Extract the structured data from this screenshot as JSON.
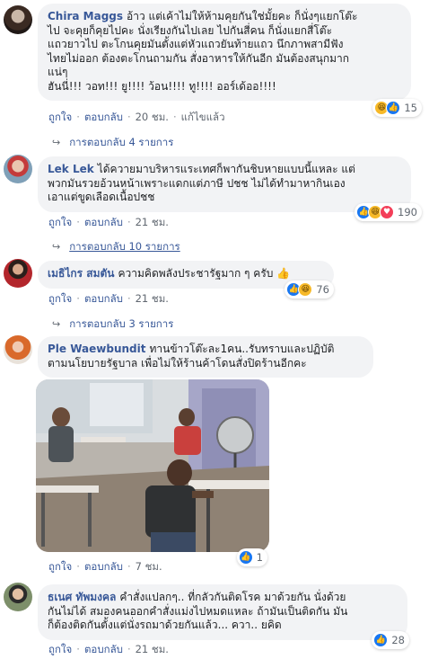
{
  "comments": [
    {
      "author": "Chira Maggs",
      "text_lines": [
        "อ้าว แต่เค้าไม่ให้ห้ามคุยกันใช่มั้ยคะ ก็นั่งๆแยกโต๊ะ",
        "ไป จะคุยก็คุยไปคะ นั่งเรียงกันไปเลย ไปกันสี่คน ก็นั่งแยกสี่โต๊ะ",
        "แถวยาวไป ตะโกนคุยมันตั้งแต่หัวแถวยันท้ายแถว นึกภาพสามีฟัง",
        "ไทยไม่ออก ต้องตะโกนถามกัน สั่งอาหารให้กันอีก มันต้องสนุกมาก",
        "แน่ๆ",
        "ฮันนี่!!! วอท!!! ยู!!!! ว้อน!!!! ทู!!!! ออร์เด้ออ!!!!"
      ],
      "like": "ถูกใจ",
      "reply": "ตอบกลับ",
      "time": "20 ชม.",
      "edited": "แก้ไขแล้ว",
      "reaction_count": "15",
      "reactions": [
        "haha",
        "like"
      ],
      "replies_text": "การตอบกลับ 4 รายการ"
    },
    {
      "author": "Lek Lek",
      "text_lines": [
        "ได้ควายมาบริหารแระเทศก็พากันชิบหายแบบนี้แหละ แต่",
        "พวกมันรวยอ้วนหน้าเพราะแดกแต่ภาษี ปชช ไม่ได้ทำมาหากินเอง",
        "เอาแต่ขูดเลือดเนื้อปชช"
      ],
      "like": "ถูกใจ",
      "reply": "ตอบกลับ",
      "time": "21 ชม.",
      "reaction_count": "190",
      "reactions": [
        "like",
        "haha",
        "love"
      ],
      "replies_text": "การตอบกลับ 10 รายการ"
    },
    {
      "author": "เมธิไกร สมตัน",
      "text_lines": [
        "ความคิดพลังประชารัฐมาก ๆ ครับ 👍"
      ],
      "like": "ถูกใจ",
      "reply": "ตอบกลับ",
      "time": "21 ชม.",
      "reaction_count": "76",
      "reactions": [
        "like",
        "haha"
      ],
      "replies_text": "การตอบกลับ 3 รายการ"
    },
    {
      "author": "Ple Waewbundit",
      "text_lines": [
        "ทานข้าวโต๊ะละ1คน..รับทราบและปฏิบัติ",
        "ตามนโยบายรัฐบาล เพื่อไม่ให้ร้านค้าโดนสั่งปิดร้านอีกคะ"
      ],
      "like": "ถูกใจ",
      "reply": "ตอบกลับ",
      "time": "7 ชม.",
      "reaction_count": "1",
      "reactions": [
        "like"
      ]
    },
    {
      "author": "ธเนศ ทัพมงคล",
      "text_lines": [
        "คำสั่งแปลกๆ.. ที่กลัวกันติดโรค มาด้วยกัน นั่งด้วย",
        "กันไม่ได้ สมองคนออกคำสั่งแม่งไปหมดแหละ ถ้ามันเป็นติดกัน มัน",
        "ก็ต้องติดกันตั้งแต่นั่งรถมาด้วยกันแล้ว... ควา.. ยคิด"
      ],
      "like": "ถูกใจ",
      "reply": "ตอบกลับ",
      "time": "21 ชม.",
      "reaction_count": "28",
      "reactions": [
        "like"
      ]
    }
  ],
  "colors": {
    "name": "#385898",
    "bubble": "#f2f3f5",
    "meta": "#606770",
    "like_blue": "#1877f2",
    "haha_yellow": "#f7b928",
    "love_red": "#f33e58"
  }
}
